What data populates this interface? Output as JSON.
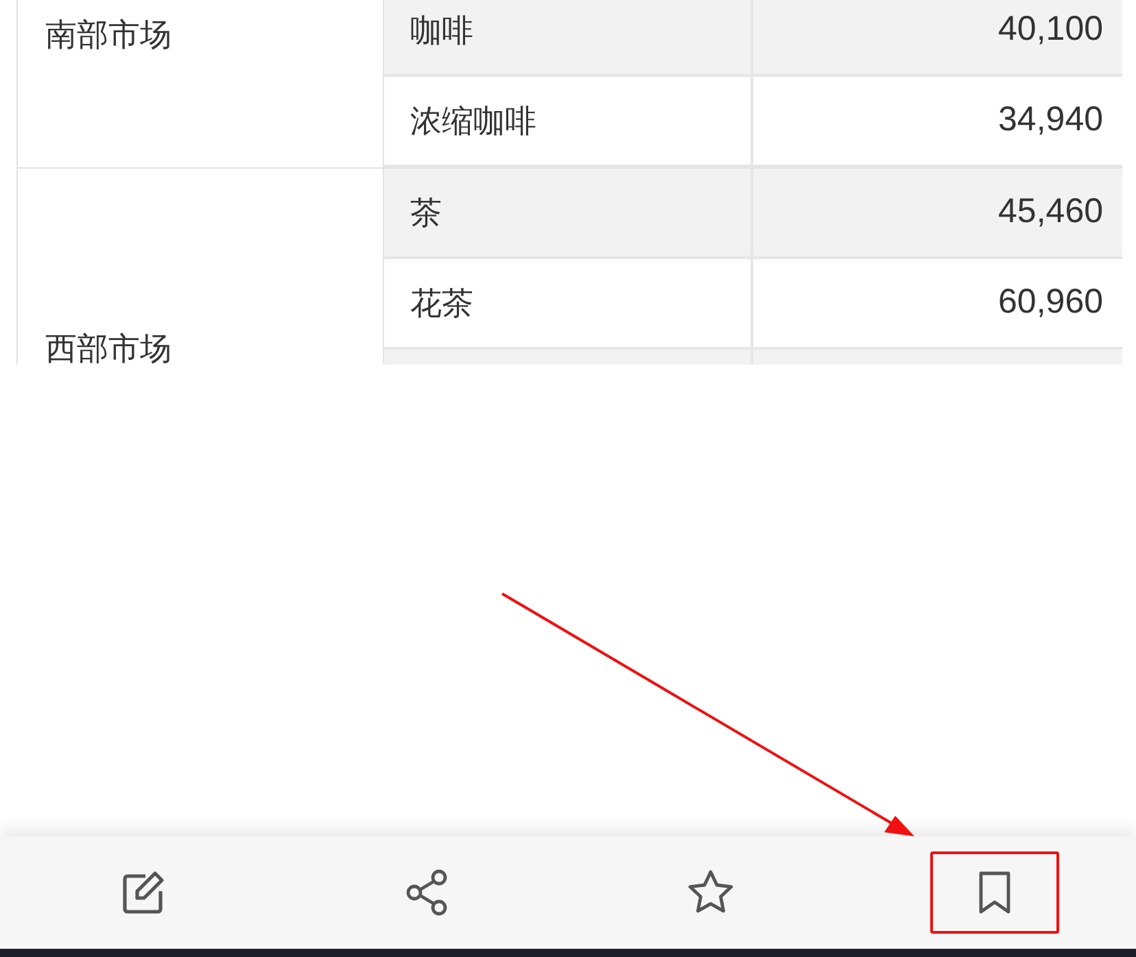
{
  "table": {
    "regions": [
      {
        "name": "南部市场",
        "rows": [
          {
            "product": "咖啡",
            "value": "40,100",
            "shaded": true
          },
          {
            "product": "浓缩咖啡",
            "value": "34,940",
            "shaded": false
          }
        ]
      },
      {
        "name": "西部市场",
        "rows": [
          {
            "product": "茶",
            "value": "45,460",
            "shaded": true
          },
          {
            "product": "花茶",
            "value": "60,960",
            "shaded": false
          }
        ]
      }
    ]
  },
  "toolbar": [
    {
      "kind": "edit",
      "highlighted": false
    },
    {
      "kind": "share",
      "highlighted": false
    },
    {
      "kind": "star",
      "highlighted": false
    },
    {
      "kind": "bookmark",
      "highlighted": true
    }
  ]
}
